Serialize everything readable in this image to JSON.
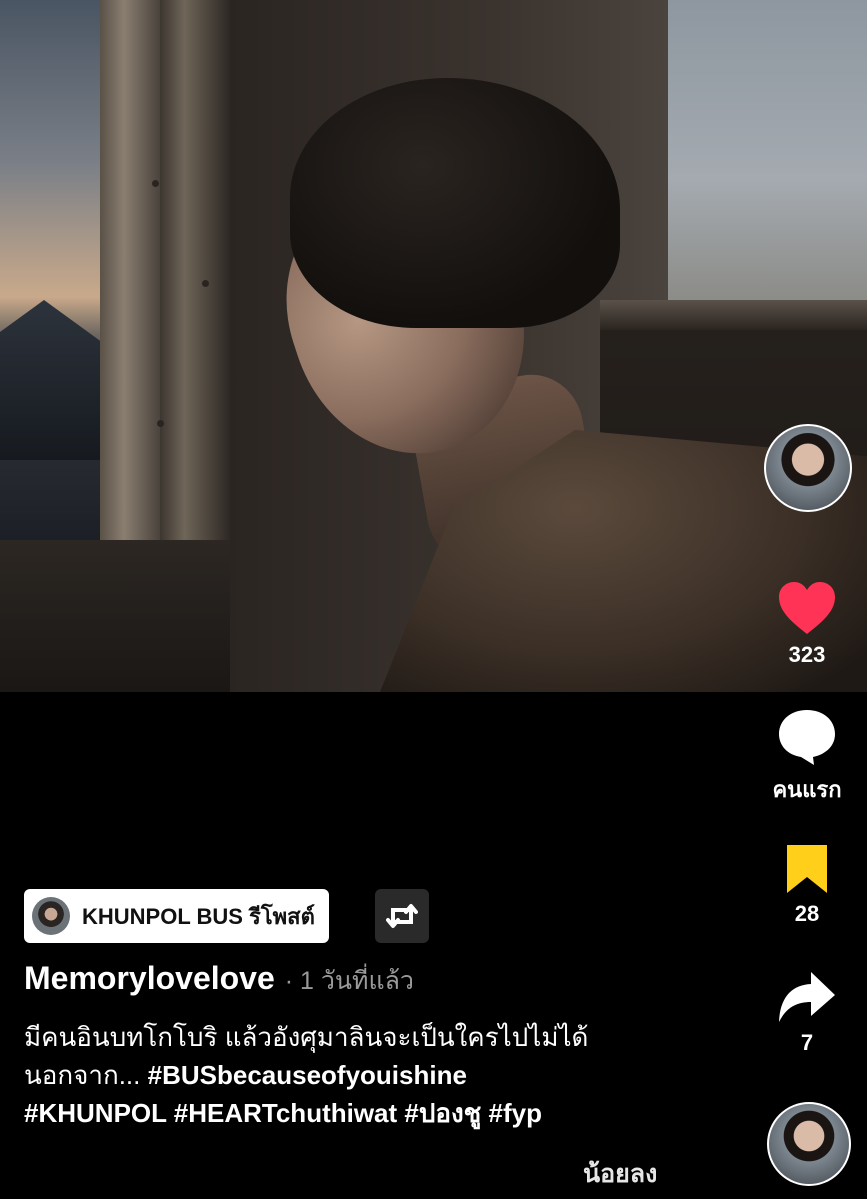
{
  "video": {
    "description_label": ""
  },
  "rail": {
    "likes": "323",
    "comments": "คนแรก",
    "saves": "28",
    "shares": "7",
    "like_color": "#ff3355",
    "save_color": "#ffcf1a"
  },
  "repost": {
    "label": "KHUNPOL BUS รีโพสต์"
  },
  "post": {
    "author": "Memorylovelove",
    "time": "· 1 วันที่แล้ว",
    "caption_line1": "มีคนอินบทโกโบริ แล้วอังศุมาลินจะเป็นใครไปไม่ได้",
    "caption_line2_prefix": "นอกจาก...",
    "caption_line2_tag": "#BUSbecauseofyouishine",
    "caption_line3": "#KHUNPOL #HEARTchuthiwat #ปองชู #fyp",
    "show_less": "น้อยลง"
  }
}
